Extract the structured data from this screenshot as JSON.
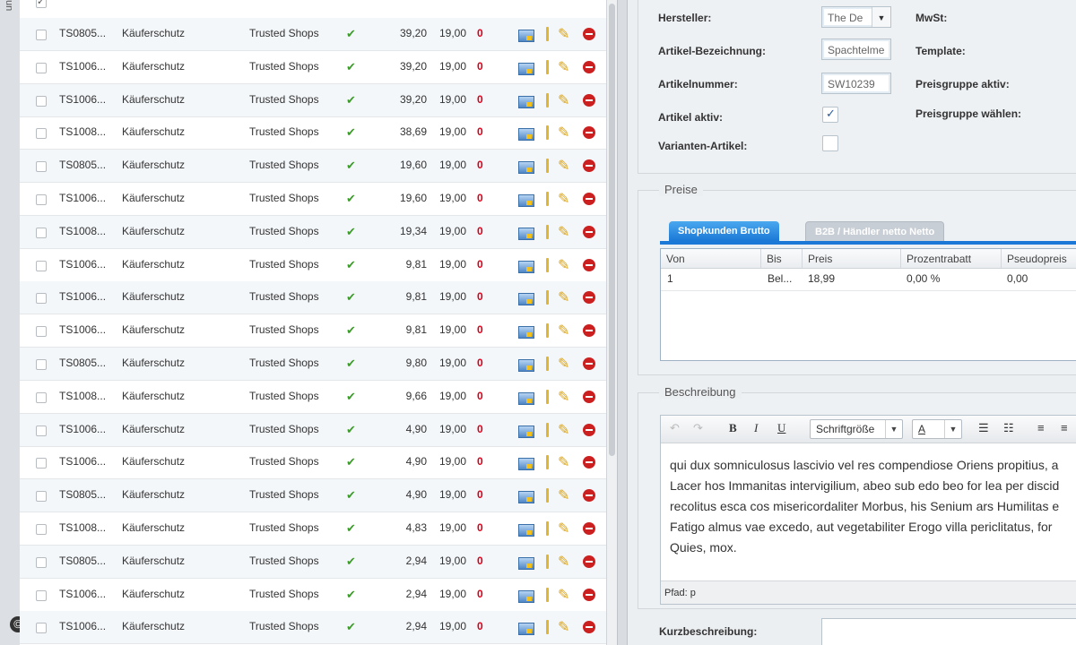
{
  "left_strip": {
    "cut_text": "un",
    "copyright": "©"
  },
  "grid": {
    "top_row": {
      "checked": true
    },
    "rows": [
      {
        "id": "TS0805...",
        "name": "Käuferschutz",
        "supplier": "Trusted Shops",
        "active": "✔",
        "price": "39,20",
        "tax": "19,00",
        "stock": "0"
      },
      {
        "id": "TS1006...",
        "name": "Käuferschutz",
        "supplier": "Trusted Shops",
        "active": "✔",
        "price": "39,20",
        "tax": "19,00",
        "stock": "0"
      },
      {
        "id": "TS1006...",
        "name": "Käuferschutz",
        "supplier": "Trusted Shops",
        "active": "✔",
        "price": "39,20",
        "tax": "19,00",
        "stock": "0"
      },
      {
        "id": "TS1008...",
        "name": "Käuferschutz",
        "supplier": "Trusted Shops",
        "active": "✔",
        "price": "38,69",
        "tax": "19,00",
        "stock": "0"
      },
      {
        "id": "TS0805...",
        "name": "Käuferschutz",
        "supplier": "Trusted Shops",
        "active": "✔",
        "price": "19,60",
        "tax": "19,00",
        "stock": "0"
      },
      {
        "id": "TS1006...",
        "name": "Käuferschutz",
        "supplier": "Trusted Shops",
        "active": "✔",
        "price": "19,60",
        "tax": "19,00",
        "stock": "0"
      },
      {
        "id": "TS1008...",
        "name": "Käuferschutz",
        "supplier": "Trusted Shops",
        "active": "✔",
        "price": "19,34",
        "tax": "19,00",
        "stock": "0"
      },
      {
        "id": "TS1006...",
        "name": "Käuferschutz",
        "supplier": "Trusted Shops",
        "active": "✔",
        "price": "9,81",
        "tax": "19,00",
        "stock": "0"
      },
      {
        "id": "TS1006...",
        "name": "Käuferschutz",
        "supplier": "Trusted Shops",
        "active": "✔",
        "price": "9,81",
        "tax": "19,00",
        "stock": "0"
      },
      {
        "id": "TS1006...",
        "name": "Käuferschutz",
        "supplier": "Trusted Shops",
        "active": "✔",
        "price": "9,81",
        "tax": "19,00",
        "stock": "0"
      },
      {
        "id": "TS0805...",
        "name": "Käuferschutz",
        "supplier": "Trusted Shops",
        "active": "✔",
        "price": "9,80",
        "tax": "19,00",
        "stock": "0"
      },
      {
        "id": "TS1008...",
        "name": "Käuferschutz",
        "supplier": "Trusted Shops",
        "active": "✔",
        "price": "9,66",
        "tax": "19,00",
        "stock": "0"
      },
      {
        "id": "TS1006...",
        "name": "Käuferschutz",
        "supplier": "Trusted Shops",
        "active": "✔",
        "price": "4,90",
        "tax": "19,00",
        "stock": "0"
      },
      {
        "id": "TS1006...",
        "name": "Käuferschutz",
        "supplier": "Trusted Shops",
        "active": "✔",
        "price": "4,90",
        "tax": "19,00",
        "stock": "0"
      },
      {
        "id": "TS0805...",
        "name": "Käuferschutz",
        "supplier": "Trusted Shops",
        "active": "✔",
        "price": "4,90",
        "tax": "19,00",
        "stock": "0"
      },
      {
        "id": "TS1008...",
        "name": "Käuferschutz",
        "supplier": "Trusted Shops",
        "active": "✔",
        "price": "4,83",
        "tax": "19,00",
        "stock": "0"
      },
      {
        "id": "TS0805...",
        "name": "Käuferschutz",
        "supplier": "Trusted Shops",
        "active": "✔",
        "price": "2,94",
        "tax": "19,00",
        "stock": "0"
      },
      {
        "id": "TS1006...",
        "name": "Käuferschutz",
        "supplier": "Trusted Shops",
        "active": "✔",
        "price": "2,94",
        "tax": "19,00",
        "stock": "0"
      },
      {
        "id": "TS1006...",
        "name": "Käuferschutz",
        "supplier": "Trusted Shops",
        "active": "✔",
        "price": "2,94",
        "tax": "19,00",
        "stock": "0"
      }
    ],
    "row_icons": [
      "image-icon",
      "thermometer-icon",
      "pencil-icon",
      "delete-icon"
    ]
  },
  "details": {
    "hersteller_label": "Hersteller:",
    "hersteller_value": "The De",
    "bezeichnung_label": "Artikel-Bezeichnung:",
    "bezeichnung_value": "Spachtelme",
    "nummer_label": "Artikelnummer:",
    "nummer_value": "SW10239",
    "aktiv_label": "Artikel aktiv:",
    "aktiv_checked": true,
    "varianten_label": "Varianten-Artikel:",
    "varianten_checked": false,
    "mwst_label": "MwSt:",
    "template_label": "Template:",
    "preisgruppe_aktiv_label": "Preisgruppe aktiv:",
    "preisgruppe_waehlen_label": "Preisgruppe wählen:"
  },
  "preise": {
    "legend": "Preise",
    "tabs": [
      "Shopkunden Brutto",
      "B2B / Händler netto Netto"
    ],
    "columns": [
      "Von",
      "Bis",
      "Preis",
      "Prozentrabatt",
      "Pseudopreis"
    ],
    "rows": [
      [
        "1",
        "Bel...",
        "18,99",
        "0,00 %",
        "0,00"
      ]
    ]
  },
  "beschreibung": {
    "legend": "Beschreibung",
    "font_size_select": "Schriftgröße",
    "font_color_label": "A",
    "lines": [
      "qui dux somniculosus lascivio vel res compendiose Oriens propitius, a",
      "Lacer hos Immanitas intervigilium, abeo sub edo beo for lea per discid",
      "recolitus esca cos misericordaliter Morbus, his Senium ars Humilitas e",
      "Fatigo almus vae excedo, aut vegetabiliter Erogo villa periclitatus, for",
      "Quies, mox."
    ],
    "path": "Pfad: p"
  },
  "kurz": {
    "label": "Kurzbeschreibung:"
  },
  "colors": {
    "accent": "#1b78d6",
    "ok": "#3d9b2b",
    "zero": "#d0021b",
    "delete": "#cc1f1f"
  }
}
